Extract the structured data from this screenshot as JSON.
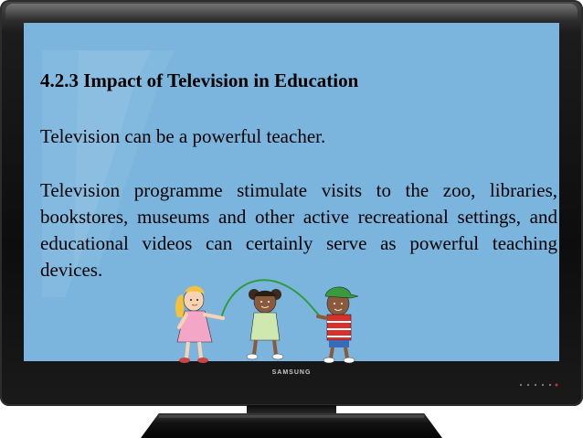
{
  "tv": {
    "brand": "SAMSUNG",
    "screen_color": "#7bb5de"
  },
  "slide": {
    "heading": "4.2.3 Impact of Television in Education",
    "paragraph1": "Television can be a powerful teacher.",
    "paragraph2": "Television programme stimulate visits to the zoo, libraries, bookstores, museums and other active recreational settings, and educational videos can certainly serve as powerful teaching devices."
  },
  "illustration": {
    "subject": "children-skipping-rope-icon"
  }
}
